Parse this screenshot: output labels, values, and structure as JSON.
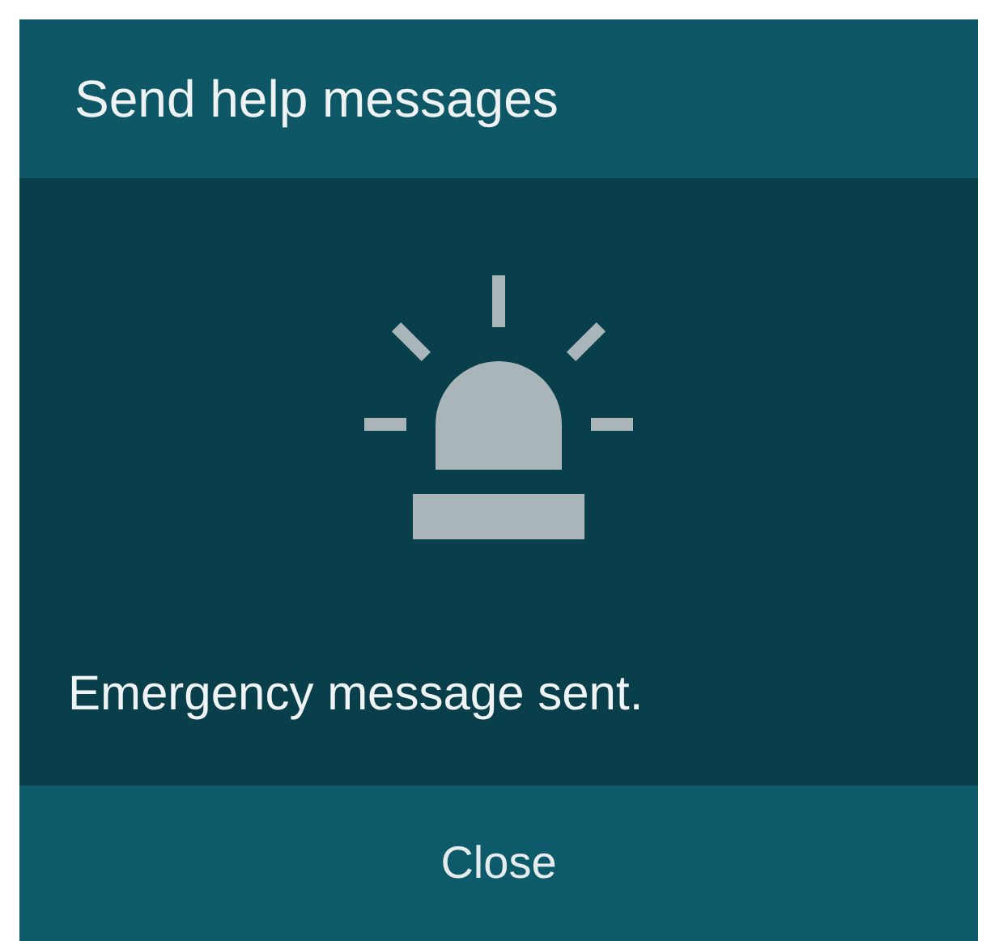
{
  "dialog": {
    "title": "Send help messages",
    "message": "Emergency message sent.",
    "buttons": [
      "Close"
    ]
  }
}
